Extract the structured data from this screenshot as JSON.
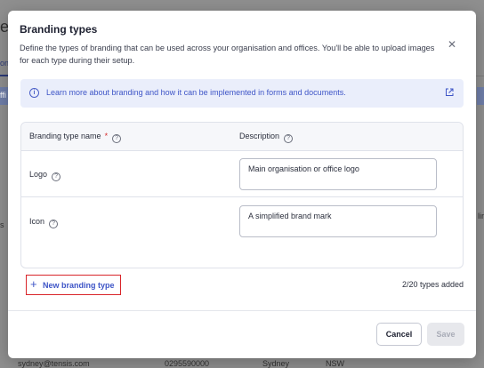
{
  "background": {
    "heading_fragment": "e",
    "tab_fragment": "on",
    "left_fragment": "ffi",
    "right_fragment": "di",
    "row_fragment_left": "s",
    "row_fragment_right": "lir",
    "footer_row": {
      "email": "sydney@tensis.com",
      "phone": "0295590000",
      "city": "Sydney",
      "state": "NSW"
    }
  },
  "modal": {
    "title": "Branding types",
    "description": "Define the types of branding that can be used across your organisation and offices. You'll be able to upload images for each type during their setup.",
    "close_icon": "close-icon",
    "info_banner": {
      "icon": "info-icon",
      "link_text": "Learn more about branding and how it can be implemented in forms and documents.",
      "external_icon": "external-link-icon"
    },
    "table": {
      "col_name": "Branding type name",
      "col_name_required": "*",
      "col_desc": "Description",
      "rows": [
        {
          "name": "Logo",
          "description": "Main organisation or office logo"
        },
        {
          "name": "Icon",
          "description": "A simplified brand mark"
        }
      ]
    },
    "new_button": {
      "icon": "+",
      "label": "New branding type"
    },
    "types_count": "2/20 types added",
    "cancel_label": "Cancel",
    "save_label": "Save"
  },
  "colors": {
    "accent": "#3e55c7",
    "info_bg": "#eaeefb",
    "highlight_border": "#d9252a",
    "required": "#d62c2c"
  }
}
